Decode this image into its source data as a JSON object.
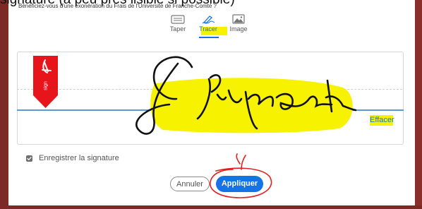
{
  "caption": {
    "cut_text": "signature (à peu près lisible si possible)",
    "sub_text": "Bénéficiez-vous d'une exonération du Frais de l'Université de Franche-Comté ?"
  },
  "tabs": [
    {
      "label": "Taper",
      "icon": "keyboard-icon",
      "selected": false
    },
    {
      "label": "Tracer",
      "icon": "pen-draw-icon",
      "selected": true
    },
    {
      "label": "Image",
      "icon": "image-icon",
      "selected": false
    }
  ],
  "ribbon": {
    "brand_icon": "acrobat-icon",
    "text": "sign"
  },
  "signature_pad": {
    "has_drawn_signature": true,
    "clear_label": "Effacer"
  },
  "save_signature": {
    "label": "Enregistrer la signature",
    "checked": true
  },
  "actions": {
    "cancel_label": "Annuler",
    "apply_label": "Appliquer"
  },
  "colors": {
    "accent": "#1473e6",
    "ribbon": "#e8141c",
    "highlight": "#f7f200",
    "annotation_circle": "#e02020",
    "frame": "#7b2a26"
  }
}
